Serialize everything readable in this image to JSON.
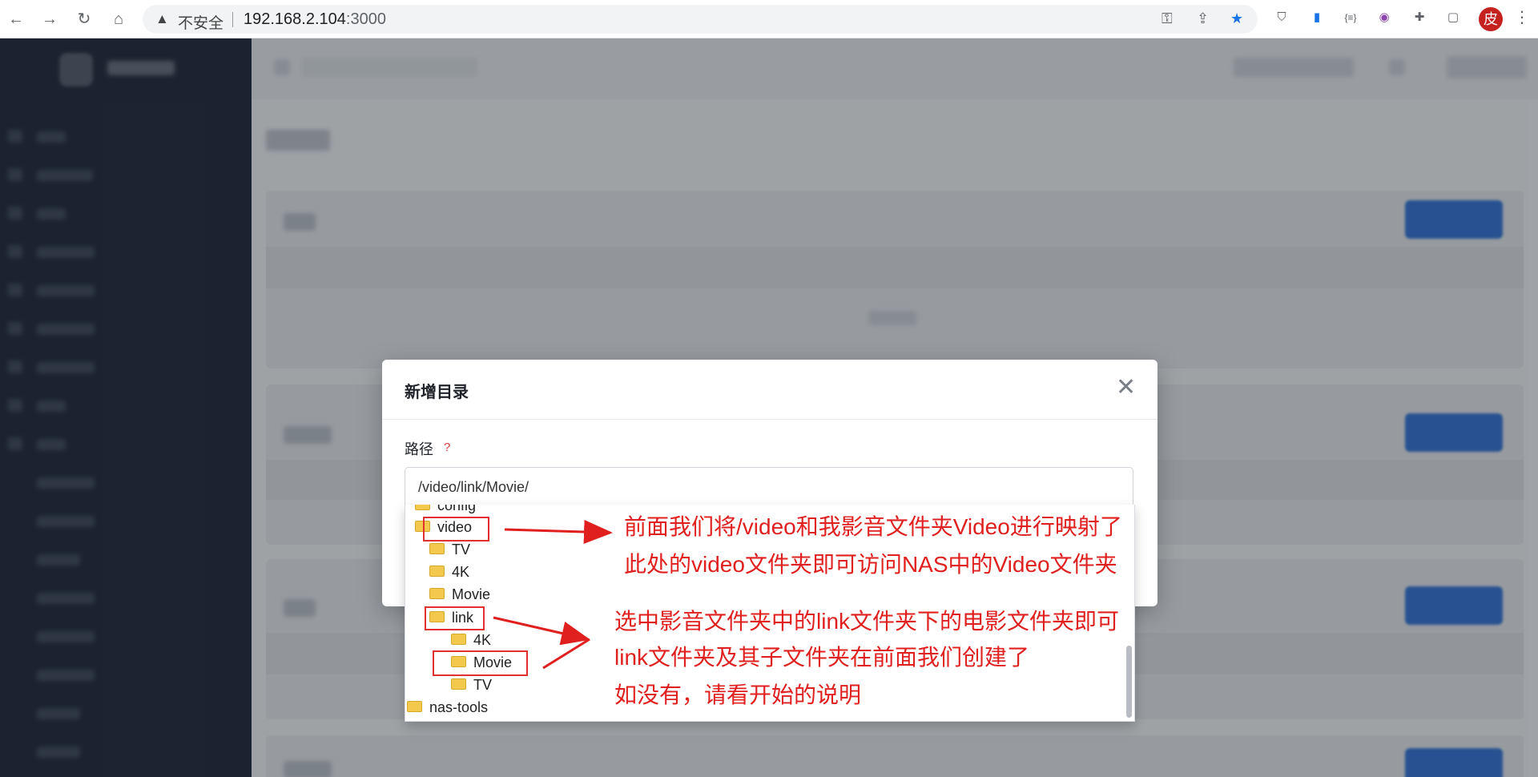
{
  "browser": {
    "security_label": "不安全",
    "url_host": "192.168.2.104",
    "url_port": ":3000",
    "profile_initial": "皮",
    "icons": [
      "back-icon",
      "forward-icon",
      "reload-icon",
      "home-icon",
      "key-icon",
      "share-icon",
      "star-icon",
      "extension-icon",
      "puzzle-icon",
      "sidebar-icon",
      "menu-icon"
    ]
  },
  "dialog": {
    "title": "新增目录",
    "path_label": "路径",
    "help_mark": "?",
    "path_value": "/video/link/Movie/"
  },
  "folder_tree": [
    {
      "name": "config",
      "level": 0
    },
    {
      "name": "video",
      "level": 0
    },
    {
      "name": "TV",
      "level": 1
    },
    {
      "name": "4K",
      "level": 1
    },
    {
      "name": "Movie",
      "level": 1
    },
    {
      "name": "link",
      "level": 1
    },
    {
      "name": "4K",
      "level": 2
    },
    {
      "name": "Movie",
      "level": 2
    },
    {
      "name": "TV",
      "level": 2
    },
    {
      "name": "nas-tools",
      "level": 0
    }
  ],
  "annotations": {
    "line1": "前面我们将/video和我影音文件夹Video进行映射了",
    "line2": "此处的video文件夹即可访问NAS中的Video文件夹",
    "line3": "选中影音文件夹中的link文件夹下的电影文件夹即可",
    "line4": "link文件夹及其子文件夹在前面我们创建了",
    "line5": "如没有，请看开始的说明",
    "color": "#e0201f"
  }
}
